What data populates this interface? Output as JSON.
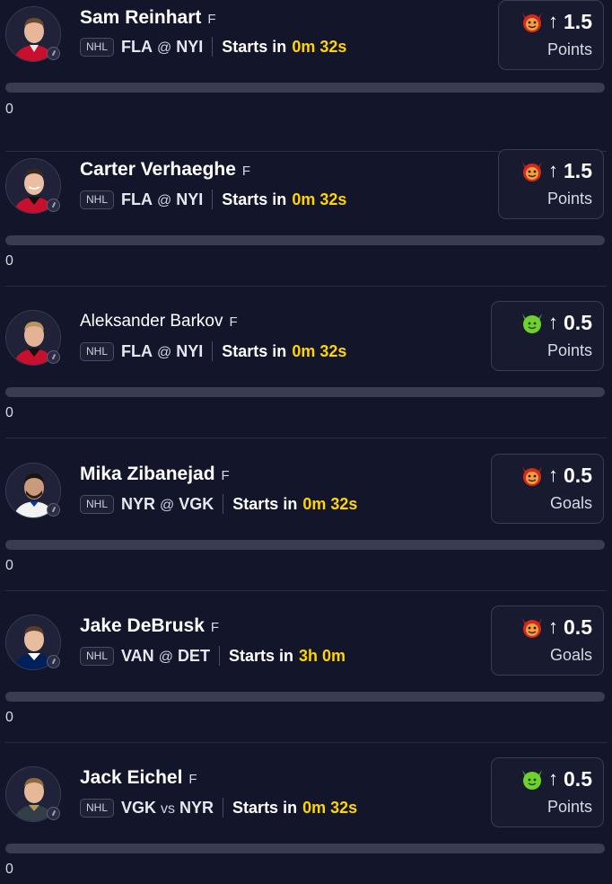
{
  "players": [
    {
      "name": "Sam Reinhart",
      "position": "F",
      "league": "NHL",
      "team": "FLA",
      "separator": "@",
      "opponent": "NYI",
      "starts_label": "Starts in",
      "starts_time": "0m 32s",
      "line": "1.5",
      "stat": "Points",
      "direction": "more",
      "emoji": "red-devil",
      "progress": 0,
      "count": "0",
      "jersey_color": "#c8102e"
    },
    {
      "name": "Carter Verhaeghe",
      "position": "F",
      "league": "NHL",
      "team": "FLA",
      "separator": "@",
      "opponent": "NYI",
      "starts_label": "Starts in",
      "starts_time": "0m 32s",
      "line": "1.5",
      "stat": "Points",
      "direction": "more",
      "emoji": "red-devil",
      "progress": 0,
      "count": "0",
      "jersey_color": "#c8102e"
    },
    {
      "name": "Aleksander Barkov",
      "position": "F",
      "league": "NHL",
      "team": "FLA",
      "separator": "@",
      "opponent": "NYI",
      "starts_label": "Starts in",
      "starts_time": "0m 32s",
      "line": "0.5",
      "stat": "Points",
      "direction": "more",
      "emoji": "green-devil",
      "progress": 0,
      "count": "0",
      "jersey_color": "#c8102e"
    },
    {
      "name": "Mika Zibanejad",
      "position": "F",
      "league": "NHL",
      "team": "NYR",
      "separator": "@",
      "opponent": "VGK",
      "starts_label": "Starts in",
      "starts_time": "0m 32s",
      "line": "0.5",
      "stat": "Goals",
      "direction": "more",
      "emoji": "red-devil",
      "progress": 0,
      "count": "0",
      "jersey_color": "#ffffff"
    },
    {
      "name": "Jake DeBrusk",
      "position": "F",
      "league": "NHL",
      "team": "VAN",
      "separator": "@",
      "opponent": "DET",
      "starts_label": "Starts in",
      "starts_time": "3h 0m",
      "line": "0.5",
      "stat": "Goals",
      "direction": "more",
      "emoji": "red-devil",
      "progress": 0,
      "count": "0",
      "jersey_color": "#00205b"
    },
    {
      "name": "Jack Eichel",
      "position": "F",
      "league": "NHL",
      "team": "VGK",
      "separator": "vs",
      "opponent": "NYR",
      "starts_label": "Starts in",
      "starts_time": "0m 32s",
      "line": "0.5",
      "stat": "Points",
      "direction": "more",
      "emoji": "green-devil",
      "progress": 0,
      "count": "0",
      "jersey_color": "#b4975a"
    }
  ],
  "colors": {
    "background": "#13152a",
    "accent_time": "#ffd400",
    "red_devil": "#d32a1e",
    "green_devil": "#6fd12c"
  },
  "icons": {
    "arrow": "↑",
    "direction_icon": "arrow-up-icon",
    "avatar_badge": "clock-icon"
  }
}
